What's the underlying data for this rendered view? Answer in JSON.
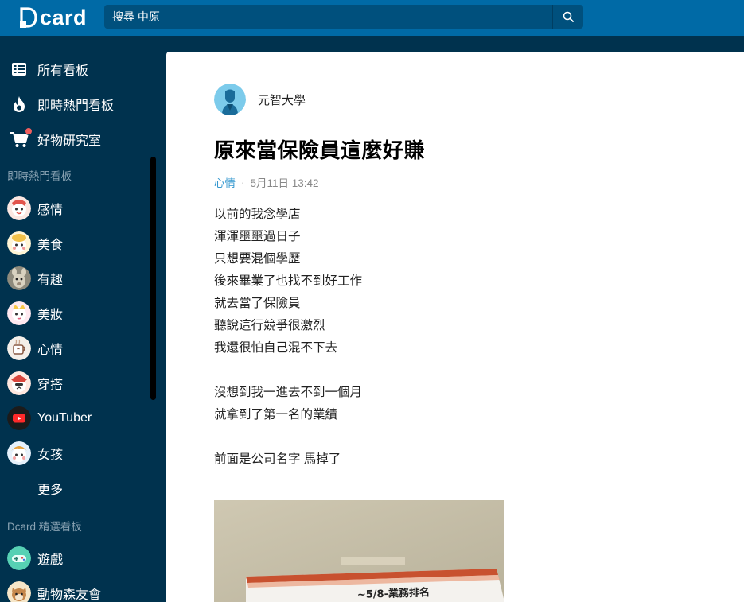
{
  "header": {
    "logo_text": "card",
    "search": {
      "value": "搜尋 中原",
      "placeholder": ""
    }
  },
  "sidebar": {
    "nav": [
      {
        "label": "所有看板",
        "icon": "list-icon"
      },
      {
        "label": "即時熱門看板",
        "icon": "fire-icon"
      },
      {
        "label": "好物研究室",
        "icon": "cart-icon"
      }
    ],
    "hot_section_title": "即時熱門看板",
    "hot_boards": [
      {
        "label": "感情"
      },
      {
        "label": "美食"
      },
      {
        "label": "有趣"
      },
      {
        "label": "美妝"
      },
      {
        "label": "心情"
      },
      {
        "label": "穿搭"
      },
      {
        "label": "YouTuber"
      },
      {
        "label": "女孩"
      }
    ],
    "more_label": "更多",
    "featured_section_title": "Dcard 精選看板",
    "featured_boards": [
      {
        "label": "遊戲"
      },
      {
        "label": "動物森友會"
      }
    ]
  },
  "post": {
    "author": "元智大學",
    "title": "原來當保險員這麼好賺",
    "forum": "心情",
    "separator": "·",
    "time": "5月11日 13:42",
    "lines": [
      "以前的我念學店",
      "渾渾噩噩過日子",
      "只想要混個學歷",
      "後來畢業了也找不到好工作",
      "就去當了保險員",
      "聽說這行競爭很激烈",
      "我還很怕自己混不下去",
      "",
      "沒想到我一進去不到一個月",
      "就拿到了第一名的業績",
      "",
      "前面是公司名字 馬掉了"
    ],
    "image_caption": "~5/8-業務排名"
  },
  "colors": {
    "header_bg": "#006aa6",
    "sidebar_bg": "#00324e",
    "accent": "#3397cf"
  }
}
